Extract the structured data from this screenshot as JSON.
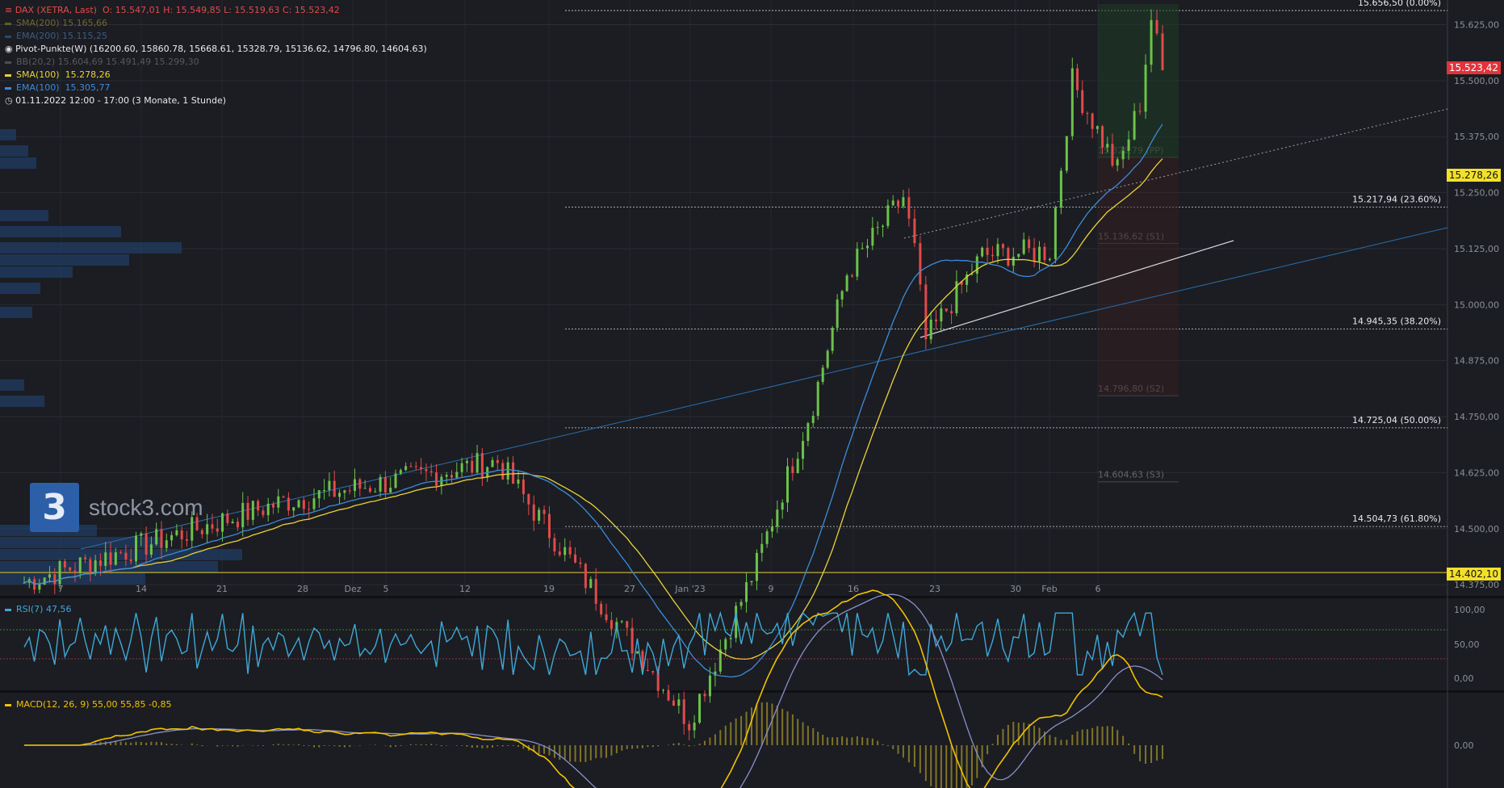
{
  "legend": {
    "symbol": "DAX (XETRA, Last)",
    "ohlc": "O: 15.547,01  H: 15.549,85  L: 15.519,63  C: 15.523,42",
    "sma200": "SMA(200)  15.165,66",
    "ema200": "EMA(200)  15.115,25",
    "pivot": "Pivot-Punkte(W)  (16200.60,  15860.78,  15668.61,  15328.79,  15136.62,  14796.80,  14604.63)",
    "bb": "BB(20,2)  15.604,69  15.491,49  15.299,30",
    "sma100_label": "SMA(100)",
    "sma100_value": "15.278,26",
    "ema100_label": "EMA(100)",
    "ema100_value": "15.305,77",
    "range": "01.11.2022 12:00 - 17:00   (3 Monate, 1 Stunde)"
  },
  "watermark": {
    "logo": "3",
    "text": "stock3.com"
  },
  "rsi_label": "RSI(7)  47,56",
  "macd_label": "MACD(12, 26, 9)  55,00  55,85  -0,85",
  "price_tags": {
    "last": "15.523,42",
    "sma100": "15.278,26",
    "level": "14.402,10"
  },
  "colors": {
    "background": "#1b1d22",
    "up": "#6cc24a",
    "down": "#e24a4a",
    "sma100": "#e8d23a",
    "ema100": "#3d8bd9",
    "rsi": "#3fa8d8",
    "macd": "#f2c200",
    "signal": "#8a8fc8"
  },
  "chart_data": {
    "type": "candlestick",
    "price_axis": {
      "ticks": [
        "15.625,00",
        "15.500,00",
        "15.375,00",
        "15.250,00",
        "15.125,00",
        "15.000,00",
        "14.875,00",
        "14.750,00",
        "14.625,00",
        "14.500,00",
        "14.375,00"
      ],
      "range": [
        14350,
        15680
      ]
    },
    "x_ticks": [
      "7",
      "14",
      "21",
      "28",
      "Dez",
      "5",
      "12",
      "19",
      "27",
      "Jan '23",
      "9",
      "16",
      "23",
      "30",
      "Feb",
      "6"
    ],
    "fibonacci": [
      {
        "label": "15.656,50 (0.00%)",
        "value": 15656.5
      },
      {
        "label": "15.217,94 (23.60%)",
        "value": 15217.94
      },
      {
        "label": "14.945,35 (38.20%)",
        "value": 14945.35
      },
      {
        "label": "14.725,04 (50.00%)",
        "value": 14725.04
      },
      {
        "label": "14.504,73 (61.80%)",
        "value": 14504.73
      }
    ],
    "pivots": [
      {
        "label": "15.328,79 (PP)",
        "value": 15328.79
      },
      {
        "label": "15.136,62 (S1)",
        "value": 15136.62
      },
      {
        "label": "14.796,80 (S2)",
        "value": 14796.8
      },
      {
        "label": "14.604,63 (S3)",
        "value": 14604.63
      }
    ],
    "key_points": [
      {
        "date": "2022-11-01",
        "close": 14380
      },
      {
        "date": "2022-11-24",
        "close": 14560
      },
      {
        "date": "2022-12-13",
        "close": 14650
      },
      {
        "date": "2022-12-30",
        "close": 14070
      },
      {
        "date": "2023-01-05",
        "close": 14420
      },
      {
        "date": "2023-01-10",
        "close": 14780
      },
      {
        "date": "2023-01-13",
        "close": 15070
      },
      {
        "date": "2023-01-18",
        "close": 15240
      },
      {
        "date": "2023-01-19",
        "close": 15120
      },
      {
        "date": "2023-01-20",
        "close": 14920
      },
      {
        "date": "2023-01-25",
        "close": 15110
      },
      {
        "date": "2023-01-31",
        "close": 15120
      },
      {
        "date": "2023-02-02",
        "close": 15500
      },
      {
        "date": "2023-02-06",
        "close": 15300
      },
      {
        "date": "2023-02-08",
        "close": 15450
      },
      {
        "date": "2023-02-09",
        "close": 15640
      },
      {
        "date": "2023-02-10",
        "close": 15523.42
      }
    ],
    "rsi_axis": [
      "100,00",
      "50,00",
      "0,00"
    ],
    "macd_axis": [
      "0,00"
    ]
  }
}
